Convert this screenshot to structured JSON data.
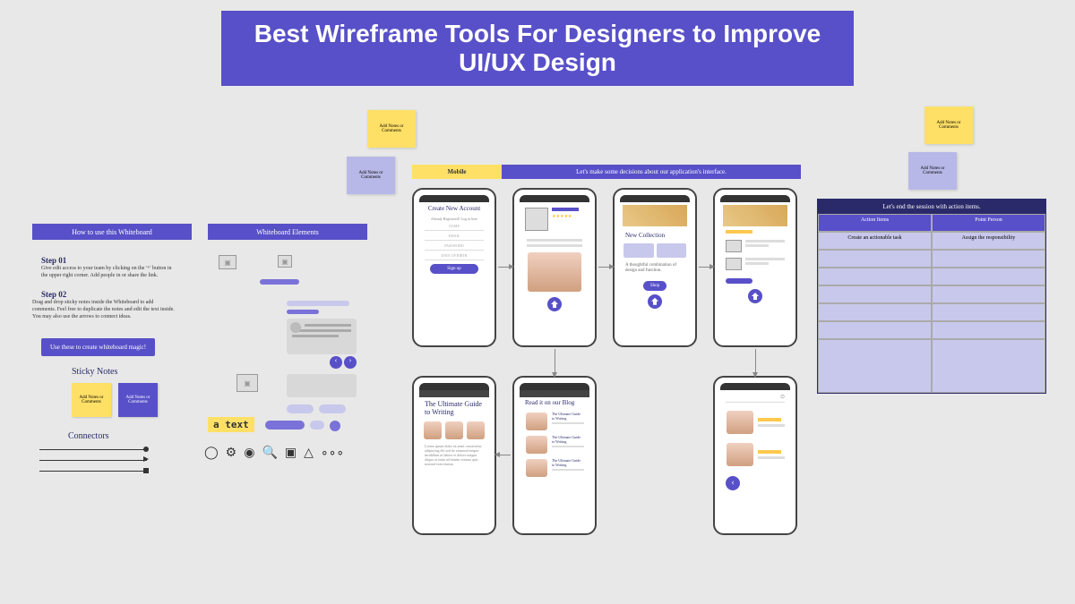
{
  "banner": "Best Wireframe Tools For Designers to Improve UI/UX Design",
  "sticky": {
    "notes": "Add Notes or Comments"
  },
  "left": {
    "hdr1": "How to use this Whiteboard",
    "step1": "Step 01",
    "step1txt": "Give edit access to your team by clicking on the '+' button in the upper right corner. Add people in or share the link.",
    "step2": "Step 02",
    "step2txt": "Drag and drop sticky notes inside the Whiteboard to add comments. Feel free to duplicate the notes and edit the text inside. You may also use the arrows to connect ideas.",
    "usebtn": "Use these to create whiteboard magic!",
    "stickyTitle": "Sticky Notes",
    "connTitle": "Connectors"
  },
  "wb": {
    "hdr": "Whiteboard Elements",
    "atext": "a text"
  },
  "tabs": {
    "mobile": "Mobile",
    "decision": "Let's make some decisions about our application's interface."
  },
  "phones": {
    "p1": {
      "title": "Create New Account",
      "sub": "Already Registered? Log in here",
      "f1": "NAME",
      "f2": "EMAIL",
      "f3": "PASSWORD",
      "f4": "DATE OF BIRTH",
      "btn": "Sign up"
    },
    "p3": {
      "title": "New Collection",
      "sub": "A thoughtful combination of design and function.",
      "btn": "Shop"
    },
    "p5": {
      "title": "The Ultimate Guide to Writing"
    },
    "p6": {
      "title": "Read it on our Blog",
      "item": "The Ultimate Guide to Writing"
    }
  },
  "table": {
    "title": "Let's end the session with action items.",
    "col1": "Action Items",
    "col2": "Point Person",
    "r1c1": "Create an actionable task",
    "r1c2": "Assign the responsibility"
  }
}
